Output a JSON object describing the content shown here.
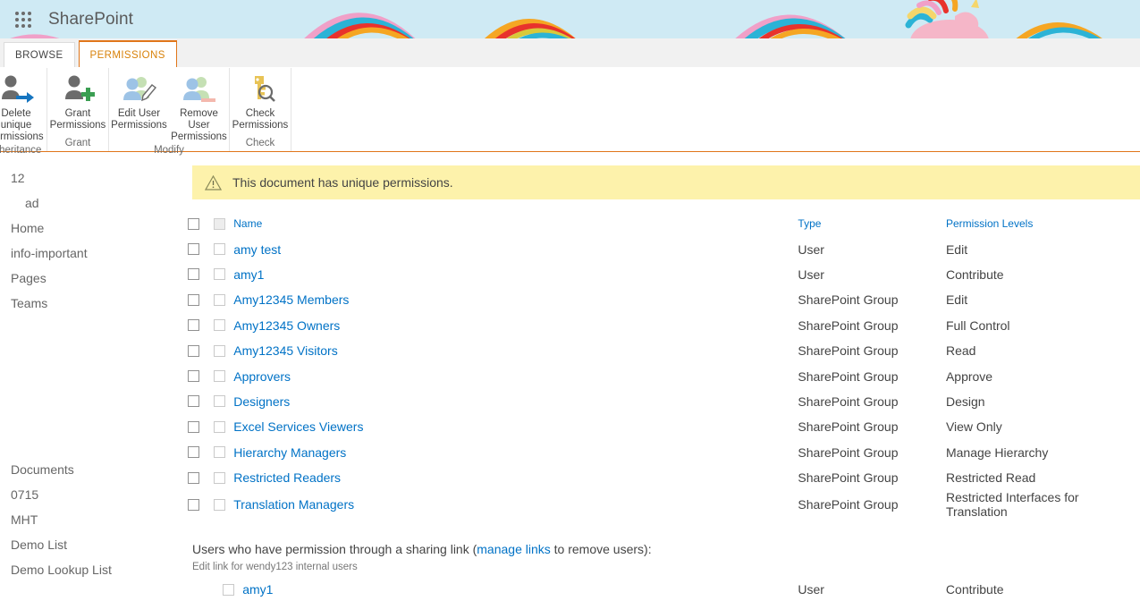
{
  "suite": {
    "app_launcher_icon": "waffle-grid-icon",
    "title": "SharePoint",
    "banner_theme_color": "#cfeaf4"
  },
  "ribbon": {
    "tabs": [
      {
        "label": "BROWSE",
        "active": false
      },
      {
        "label": "PERMISSIONS",
        "active": true
      }
    ],
    "active_tab_color": "#e0761a",
    "groups": [
      {
        "title": "Inheritance",
        "items": [
          {
            "label": "Delete unique\npermissions",
            "icon": "user-arrow-icon"
          }
        ]
      },
      {
        "title": "Grant",
        "items": [
          {
            "label": "Grant\nPermissions",
            "icon": "user-plus-icon"
          }
        ]
      },
      {
        "title": "Modify",
        "items": [
          {
            "label": "Edit User\nPermissions",
            "icon": "users-pencil-icon"
          },
          {
            "label": "Remove User\nPermissions",
            "icon": "users-minus-icon"
          }
        ]
      },
      {
        "title": "Check",
        "items": [
          {
            "label": "Check\nPermissions",
            "icon": "key-magnifier-icon"
          }
        ]
      }
    ]
  },
  "sidebar": {
    "items": [
      {
        "label": "12",
        "sub": false
      },
      {
        "label": "ad",
        "sub": true
      },
      {
        "label": "Home",
        "sub": false
      },
      {
        "label": "info-important",
        "sub": false
      },
      {
        "label": "Pages",
        "sub": false
      },
      {
        "label": "Teams",
        "sub": false
      }
    ],
    "items_lower": [
      {
        "label": "Documents"
      },
      {
        "label": "0715"
      },
      {
        "label": "MHT"
      },
      {
        "label": "Demo List"
      },
      {
        "label": "Demo Lookup List"
      }
    ]
  },
  "notice": {
    "icon": "warning-triangle-icon",
    "text": "This document has unique permissions.",
    "background": "#fdf2ab"
  },
  "table": {
    "headers": {
      "name": "Name",
      "type": "Type",
      "permission_levels": "Permission Levels"
    },
    "rows": [
      {
        "name": "amy test",
        "type": "User",
        "permission": "Edit"
      },
      {
        "name": "amy1",
        "type": "User",
        "permission": "Contribute"
      },
      {
        "name": "Amy12345 Members",
        "type": "SharePoint Group",
        "permission": "Edit"
      },
      {
        "name": "Amy12345 Owners",
        "type": "SharePoint Group",
        "permission": "Full Control"
      },
      {
        "name": "Amy12345 Visitors",
        "type": "SharePoint Group",
        "permission": "Read"
      },
      {
        "name": "Approvers",
        "type": "SharePoint Group",
        "permission": "Approve"
      },
      {
        "name": "Designers",
        "type": "SharePoint Group",
        "permission": "Design"
      },
      {
        "name": "Excel Services Viewers",
        "type": "SharePoint Group",
        "permission": "View Only"
      },
      {
        "name": "Hierarchy Managers",
        "type": "SharePoint Group",
        "permission": "Manage Hierarchy"
      },
      {
        "name": "Restricted Readers",
        "type": "SharePoint Group",
        "permission": "Restricted Read"
      },
      {
        "name": "Translation Managers",
        "type": "SharePoint Group",
        "permission": "Restricted Interfaces for Translation"
      }
    ]
  },
  "sharing": {
    "text_before": "Users who have permission through a sharing link (",
    "link": "manage links",
    "text_after": " to remove users):",
    "subtitle": "Edit link for wendy123 internal users",
    "rows": [
      {
        "name": "amy1",
        "type": "User",
        "permission": "Contribute"
      }
    ]
  },
  "colors": {
    "link": "#0072c6",
    "accent_orange": "#e0761a",
    "notice_yellow": "#fdf2ab"
  }
}
